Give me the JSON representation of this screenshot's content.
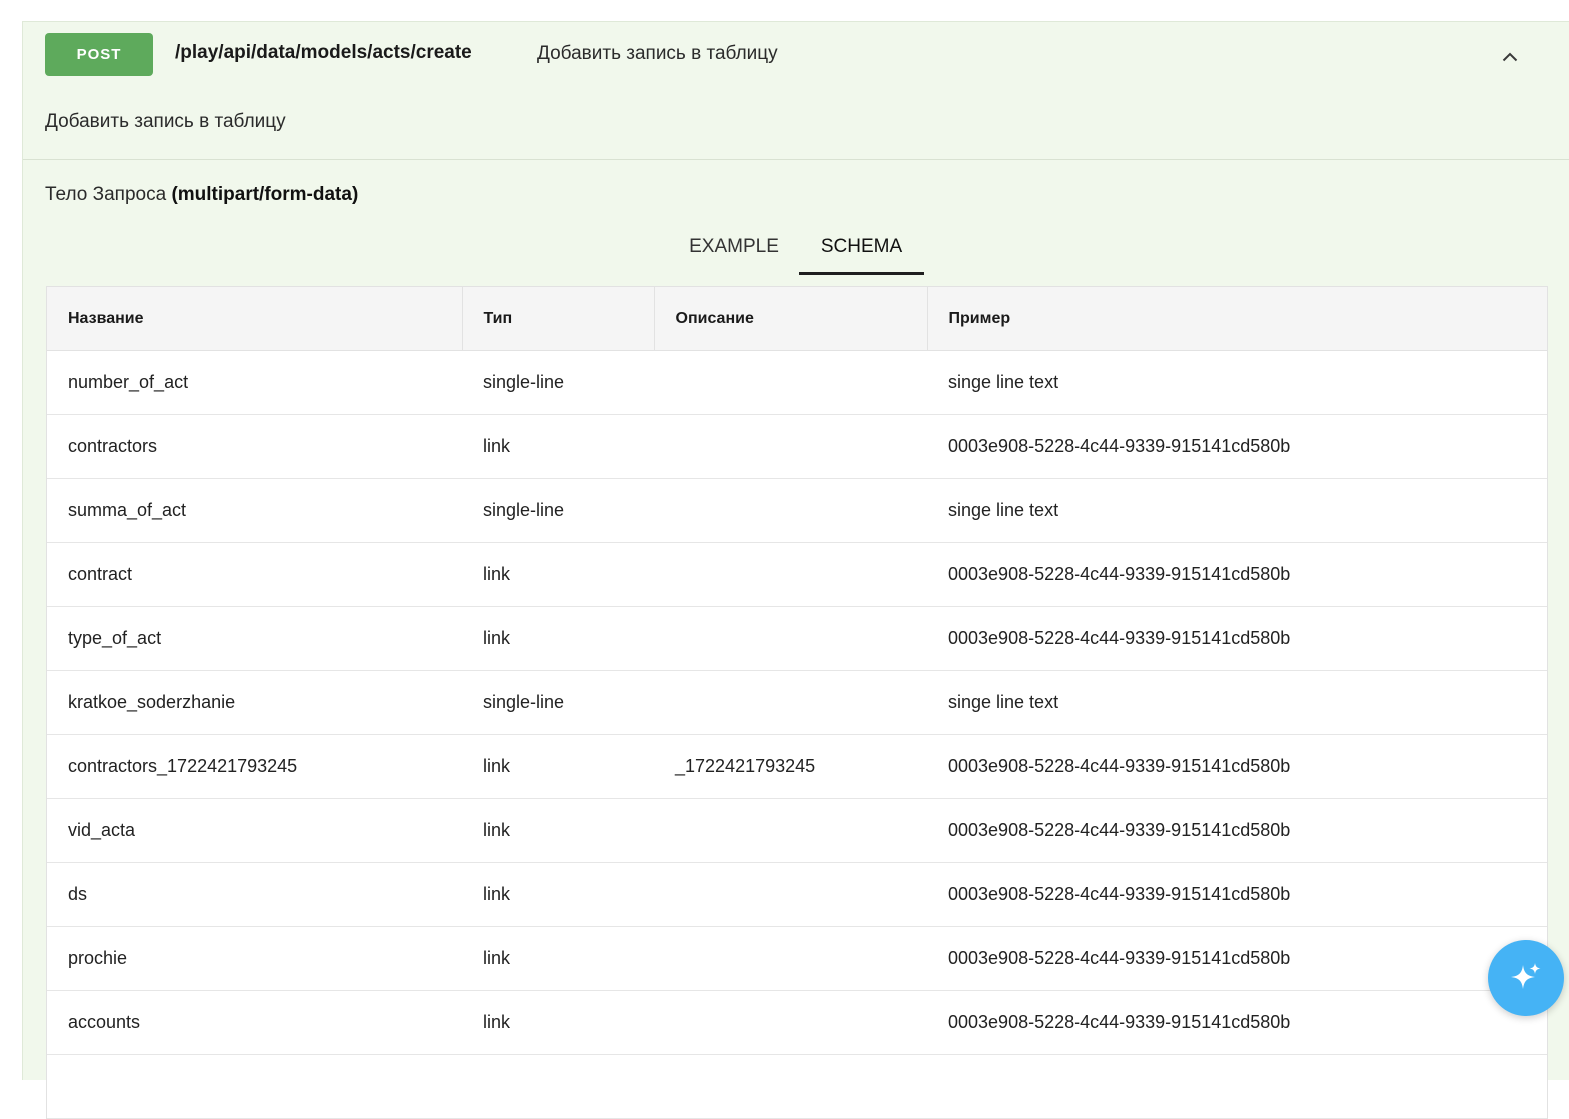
{
  "endpoint": {
    "method": "POST",
    "path": "/play/api/data/models/acts/create",
    "summary": "Добавить запись в таблицу",
    "description": "Добавить запись в таблицу",
    "collapse_icon": "chevron-up-icon"
  },
  "request_body": {
    "label": "Тело Запроса",
    "content_type": "(multipart/form-data)"
  },
  "tabs": [
    {
      "label": "EXAMPLE",
      "active": false
    },
    {
      "label": "SCHEMA",
      "active": true
    }
  ],
  "schema_table": {
    "headers": [
      "Название",
      "Тип",
      "Описание",
      "Пример"
    ],
    "rows": [
      [
        "number_of_act",
        "single-line",
        "",
        "singe line text"
      ],
      [
        "contractors",
        "link",
        "",
        "0003e908-5228-4c44-9339-915141cd580b"
      ],
      [
        "summa_of_act",
        "single-line",
        "",
        "singe line text"
      ],
      [
        "contract",
        "link",
        "",
        "0003e908-5228-4c44-9339-915141cd580b"
      ],
      [
        "type_of_act",
        "link",
        "",
        "0003e908-5228-4c44-9339-915141cd580b"
      ],
      [
        "kratkoe_soderzhanie",
        "single-line",
        "",
        "singe line text"
      ],
      [
        "contractors_1722421793245",
        "link",
        "_1722421793245",
        "0003e908-5228-4c44-9339-915141cd580b"
      ],
      [
        "vid_acta",
        "link",
        "",
        "0003e908-5228-4c44-9339-915141cd580b"
      ],
      [
        "ds",
        "link",
        "",
        "0003e908-5228-4c44-9339-915141cd580b"
      ],
      [
        "prochie",
        "link",
        "",
        "0003e908-5228-4c44-9339-915141cd580b"
      ],
      [
        "accounts",
        "link",
        "",
        "0003e908-5228-4c44-9339-915141cd580b"
      ],
      [
        "",
        "",
        "",
        ""
      ]
    ]
  },
  "fab": {
    "icon": "sparkle-icon"
  },
  "colors": {
    "post_badge": "#5eaa5c",
    "panel_bg": "#f1f8ec",
    "fab": "#45b3f5"
  }
}
